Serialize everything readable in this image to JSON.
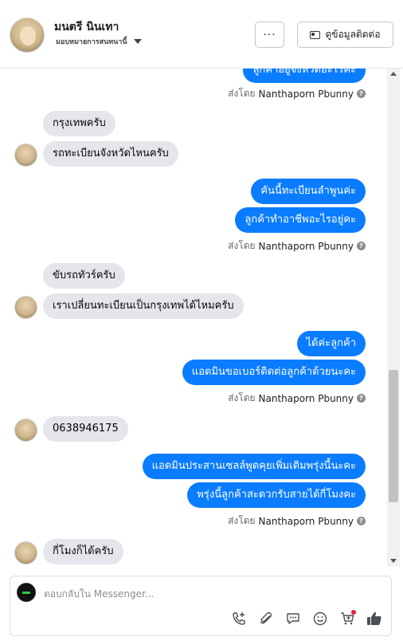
{
  "header": {
    "contact_name": "มนตรี นินเทา",
    "assign_label": "มอบหมายการสนทนานี้",
    "more_label": "···",
    "view_info_label": "ดูข้อมูลติดต่อ"
  },
  "messages": {
    "top_partial": "ลูกค้าอยู่จังหวัดอะไรคะ",
    "sent_by_prefix": "ส่งโดย",
    "sender_name": "Nanthaporn Pbunny",
    "in_1a": "กรุงเทพครับ",
    "in_1b": "รถทะเบียนจังหวัดไหนครับ",
    "out_1a": "คันนี้ทะเบียนลำพูนค่ะ",
    "out_1b": "ลูกค้าทำอาชีพอะไรอยู่คะ",
    "in_2a": "ขับรถทัวร์ครับ",
    "in_2b": "เราเปลี่ยนทะเบียนเป็นกรุงเทพได้ไหมครับ",
    "out_2a": "ได้ค่ะลูกค้า",
    "out_2b": "แอดมินขอเบอร์ติดต่อลูกค้าด้วยนะคะ",
    "in_3": "0638946175",
    "out_3a": "แอดมินประสานเซลล์พูดคุยเพิ่มเติมพรุ่งนี้นะคะ",
    "out_3b": "พรุ่งนี้ลูกค้าสะดวกรับสายได้กี่โมงคะ",
    "in_4": "กี่โมงก็ได้ครับ"
  },
  "composer": {
    "placeholder": "ตอบกลับใน Messenger..."
  },
  "colors": {
    "outgoing_bubble": "#0a7cff",
    "incoming_bubble": "#e4e6eb"
  },
  "icons": [
    "phone-plus-icon",
    "attachment-icon",
    "chat-bubble-icon",
    "emoji-icon",
    "cart-add-icon",
    "like-icon"
  ]
}
